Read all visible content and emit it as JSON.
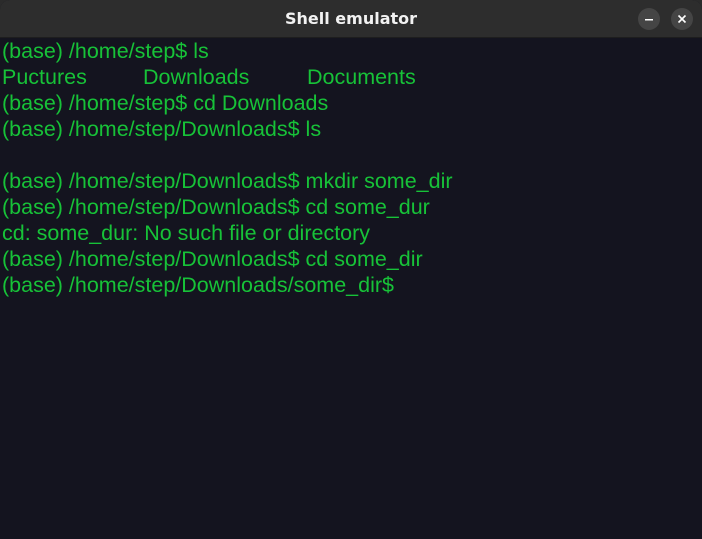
{
  "window": {
    "title": "Shell emulator",
    "minimize_icon": "minimize-icon",
    "close_icon": "close-icon"
  },
  "colors": {
    "terminal_background": "#14141f",
    "terminal_text": "#17c238",
    "titlebar": "#2d2d2d"
  },
  "terminal": {
    "lines": [
      "(base) /home/step$ ls",
      "",
      "(base) /home/step$ cd Downloads",
      "(base) /home/step/Downloads$ ls",
      "",
      "(base) /home/step/Downloads$ mkdir some_dir",
      "(base) /home/step/Downloads$ cd some_dur",
      "cd: some_dur: No such file or directory",
      "(base) /home/step/Downloads$ cd some_dir",
      "(base) /home/step/Downloads/some_dir$"
    ],
    "ls_output": [
      "Puctures",
      "Downloads",
      "Documents"
    ]
  }
}
